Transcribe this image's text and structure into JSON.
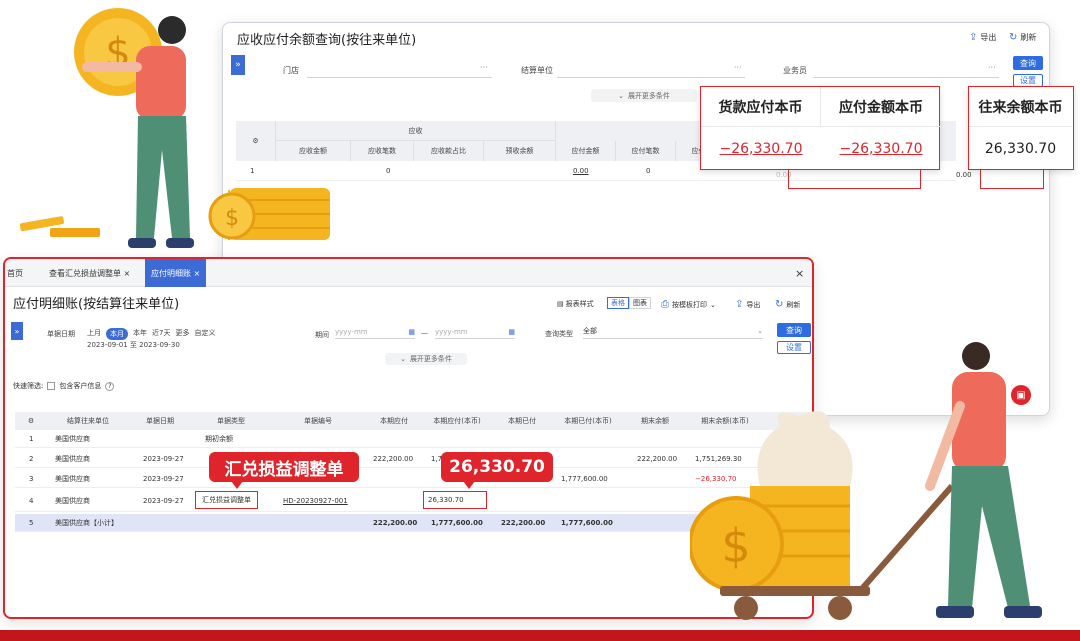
{
  "back_window": {
    "title": "应收应付余额查询(按往来单位)",
    "toolbar": {
      "export_label": "导出",
      "refresh_label": "刷新"
    },
    "filters": {
      "store_label": "门店",
      "settle_unit_label": "结算单位",
      "salesman_label": "业务员"
    },
    "query_btn": "查询",
    "settings_btn": "设置",
    "expand_more": "展开更多条件",
    "columns": {
      "group_receivable": "应收",
      "receivable_amount": "应收金额",
      "receivable_count": "应收笔数",
      "receivable_ratio": "应收款占比",
      "advance_receipt": "预收余额",
      "payable_amount": "应付金额",
      "payable_count": "应付笔数",
      "payable_ratio": "应付款占"
    },
    "row": {
      "index": "1",
      "receivable_count": "0",
      "payable_amount": "0.00",
      "payable_count": "0",
      "partial_a": "0.00",
      "partial_b": "0.00"
    }
  },
  "callouts": {
    "goods_payable": {
      "label": "货款应付本币",
      "value": "−26,330.70"
    },
    "payable_amount": {
      "label": "应付金额本币",
      "value": "−26,330.70"
    },
    "balance": {
      "label": "往来余额本币",
      "value": "26,330.70"
    }
  },
  "front_window": {
    "tabs": {
      "home": "首页",
      "tab1": "查看汇兑损益调整单 ×",
      "tab2": "应付明细账 ×"
    },
    "close_icon": "×",
    "title": "应付明细账(按结算往来单位)",
    "view_mode_label": "报表样式",
    "view_table": "表格",
    "view_chart": "图表",
    "print_label": "按模板打印",
    "export_label": "导出",
    "refresh_label": "刷新",
    "date_label": "单据日期",
    "periods": [
      "上月",
      "本月",
      "本年",
      "近7天",
      "更多",
      "自定义"
    ],
    "date_range": "2023-09-01 至 2023-09-30",
    "period_label": "期间",
    "date_placeholder": "yyyy-mm",
    "date_sep": "—",
    "query_type_label": "查询类型",
    "query_type_value": "全部",
    "query_btn": "查询",
    "settings_btn": "设置",
    "expand_more": "展开更多条件",
    "quick_filter_label": "快速筛选:",
    "include_customer": "包含客户信息",
    "help_icon": "?",
    "table": {
      "headers": [
        "结算往来单位",
        "单据日期",
        "单据类型",
        "单据编号",
        "本期应付",
        "本期应付(本币)",
        "本期已付",
        "本期已付(本币)",
        "期末余额",
        "期末余额(本币)"
      ],
      "rows": [
        {
          "idx": "1",
          "unit": "美国供应商",
          "date": "",
          "type": "期初余额",
          "no": "",
          "payable": "",
          "payable_local": "",
          "paid": "",
          "paid_local": "",
          "end_bal": "",
          "end_bal_local": ""
        },
        {
          "idx": "2",
          "unit": "美国供应商",
          "date": "2023-09-27",
          "type": "",
          "no": "",
          "payable": "222,200.00",
          "payable_local": "1,7",
          "paid": "",
          "paid_local": "",
          "end_bal": "222,200.00",
          "end_bal_local": "1,751,269.30"
        },
        {
          "idx": "3",
          "unit": "美国供应商",
          "date": "2023-09-27",
          "type": "",
          "no": "",
          "payable": "",
          "payable_local": "",
          "paid": "",
          "paid_local": "1,777,600.00",
          "end_bal": "",
          "end_bal_local": "−26,330.70"
        },
        {
          "idx": "4",
          "unit": "美国供应商",
          "date": "2023-09-27",
          "type": "汇兑损益调整单",
          "no": "HD-20230927-001",
          "payable": "",
          "payable_local": "26,330.70",
          "paid": "",
          "paid_local": "",
          "end_bal": "",
          "end_bal_local": ""
        },
        {
          "idx": "5",
          "unit": "美国供应商【小计】",
          "date": "",
          "type": "",
          "no": "",
          "payable": "222,200.00",
          "payable_local": "1,777,600.00",
          "paid": "222,200.00",
          "paid_local": "1,777,600.00",
          "end_bal": "",
          "end_bal_local": ""
        }
      ]
    },
    "bubble_type": "汇兑损益调整单",
    "bubble_value": "26,330.70"
  },
  "colors": {
    "accent_red": "#e0242b",
    "accent_blue": "#2f6ce0",
    "coin_gold": "#f5b521",
    "figure_shirt": "#ee6b5c",
    "figure_pants": "#4f8f76"
  }
}
